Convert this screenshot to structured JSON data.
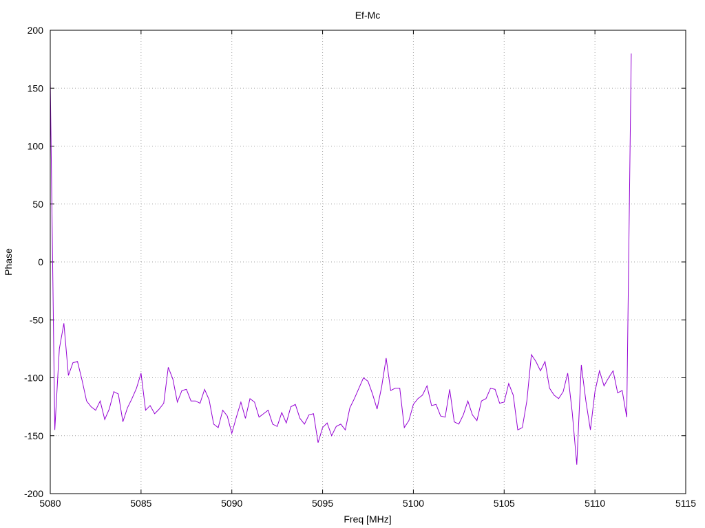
{
  "chart_data": {
    "type": "line",
    "title": "Ef-Mc",
    "xlabel": "Freq [MHz]",
    "ylabel": "Phase",
    "xlim": [
      5080,
      5115
    ],
    "ylim": [
      -200,
      200
    ],
    "xticks": [
      5080,
      5085,
      5090,
      5095,
      5100,
      5105,
      5110,
      5115
    ],
    "yticks": [
      -200,
      -150,
      -100,
      -50,
      0,
      50,
      100,
      150,
      200
    ],
    "grid": true,
    "line_color": "#9400d3",
    "series": [
      {
        "x": [
          5080.0,
          5080.25,
          5080.5,
          5080.75,
          5081.0,
          5081.25,
          5081.5,
          5081.75,
          5082.0,
          5082.25,
          5082.5,
          5082.75,
          5083.0,
          5083.25,
          5083.5,
          5083.75,
          5084.0,
          5084.25,
          5084.5,
          5084.75,
          5085.0,
          5085.25,
          5085.5,
          5085.75,
          5086.0,
          5086.25,
          5086.5,
          5086.75,
          5087.0,
          5087.25,
          5087.5,
          5087.75,
          5088.0,
          5088.25,
          5088.5,
          5088.75,
          5089.0,
          5089.25,
          5089.5,
          5089.75,
          5090.0,
          5090.25,
          5090.5,
          5090.75,
          5091.0,
          5091.25,
          5091.5,
          5091.75,
          5092.0,
          5092.25,
          5092.5,
          5092.75,
          5093.0,
          5093.25,
          5093.5,
          5093.75,
          5094.0,
          5094.25,
          5094.5,
          5094.75,
          5095.0,
          5095.25,
          5095.5,
          5095.75,
          5096.0,
          5096.25,
          5096.5,
          5096.75,
          5097.0,
          5097.25,
          5097.5,
          5097.75,
          5098.0,
          5098.25,
          5098.5,
          5098.75,
          5099.0,
          5099.25,
          5099.5,
          5099.75,
          5100.0,
          5100.25,
          5100.5,
          5100.75,
          5101.0,
          5101.25,
          5101.5,
          5101.75,
          5102.0,
          5102.25,
          5102.5,
          5102.75,
          5103.0,
          5103.25,
          5103.5,
          5103.75,
          5104.0,
          5104.25,
          5104.5,
          5104.75,
          5105.0,
          5105.25,
          5105.5,
          5105.75,
          5106.0,
          5106.25,
          5106.5,
          5106.75,
          5107.0,
          5107.25,
          5107.5,
          5107.75,
          5108.0,
          5108.25,
          5108.5,
          5108.75,
          5109.0,
          5109.25,
          5109.5,
          5109.75,
          5110.0,
          5110.25,
          5110.5,
          5110.75,
          5111.0,
          5111.25,
          5111.5,
          5111.75,
          5112.0
        ],
        "y": [
          157,
          -145,
          -75,
          -53,
          -98,
          -87,
          -86,
          -102,
          -120,
          -125,
          -128,
          -120,
          -136,
          -127,
          -112,
          -114,
          -138,
          -126,
          -118,
          -109,
          -96,
          -128,
          -124,
          -131,
          -127,
          -122,
          -91,
          -101,
          -121,
          -111,
          -110,
          -120,
          -120,
          -122,
          -110,
          -119,
          -140,
          -143,
          -128,
          -133,
          -148,
          -134,
          -121,
          -135,
          -118,
          -121,
          -134,
          -131,
          -128,
          -140,
          -142,
          -130,
          -139,
          -125,
          -123,
          -135,
          -140,
          -132,
          -131,
          -156,
          -143,
          -139,
          -150,
          -142,
          -140,
          -145,
          -126,
          -118,
          -109,
          -100,
          -103,
          -114,
          -127,
          -108,
          -83,
          -111,
          -109,
          -109,
          -143,
          -137,
          -123,
          -118,
          -115,
          -107,
          -124,
          -123,
          -133,
          -134,
          -110,
          -138,
          -140,
          -132,
          -120,
          -132,
          -137,
          -120,
          -118,
          -109,
          -110,
          -122,
          -121,
          -105,
          -115,
          -145,
          -143,
          -120,
          -80,
          -86,
          -94,
          -86,
          -109,
          -115,
          -118,
          -112,
          -96,
          -130,
          -175,
          -89,
          -120,
          -145,
          -112,
          -94,
          -107,
          -100,
          -94,
          -113,
          -111,
          -134,
          180
        ]
      }
    ]
  }
}
